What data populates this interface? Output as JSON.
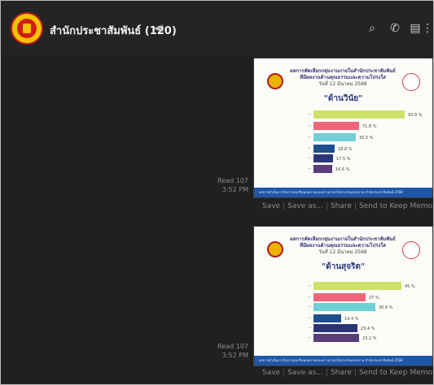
{
  "header": {
    "title": "สำนักประชาสัมพันธ์ (120)",
    "speaker_icon": "speaker-icon",
    "icons": [
      "search-icon",
      "phone-icon",
      "notes-icon",
      "more-icon"
    ]
  },
  "messages": [
    {
      "read": "Read 107",
      "time": "3:52 PM",
      "card": {
        "headline": "ผลการคัดเลือกกลุ่มงานภายในสำนักประชาสัมพันธ์ ที่มีผลงานด้านคุณธรรมและความโปร่งใส",
        "subline": "วันที่ 12 มีนาคม 2568",
        "heading": "\"ด้านวินัย\"",
        "values": [
          "93.8 %",
          "71.8 %",
          "35.5 %",
          "18.8 %",
          "17.5 %",
          "16.6 %"
        ],
        "footer": "ผลการดำเนินการในการส่งเสริมคุณธรรมและความโปร่งใสภายในหน่วยงาน สำนักประชาสัมพันธ์ 2568"
      },
      "actions": [
        "Save",
        "Save as...",
        "Share",
        "Send to Keep Memo"
      ]
    },
    {
      "read": "Read 107",
      "time": "3:52 PM",
      "card": {
        "headline": "ผลการคัดเลือกกลุ่มงานภายในสำนักประชาสัมพันธ์ ที่มีผลงานด้านคุณธรรมและความโปร่งใส",
        "subline": "วันที่ 12 มีนาคม 2568",
        "heading": "\"ด้านสุจริต\"",
        "values": [
          "45 %",
          "27 %",
          "30.6 %",
          "14.4 %",
          "23.4 %",
          "23.2 %"
        ],
        "footer": "ผลการดำเนินการในการส่งเสริมคุณธรรมและความโปร่งใสภายในหน่วยงาน สำนักประชาสัมพันธ์ 2568"
      },
      "actions": [
        "Save",
        "Save as...",
        "Share",
        "Send to Keep Memo"
      ]
    }
  ],
  "colors": {
    "bars": [
      "#cfe06a",
      "#f0657a",
      "#6fd1d6",
      "#1e4f8c",
      "#2b3474",
      "#5a3d79"
    ]
  }
}
